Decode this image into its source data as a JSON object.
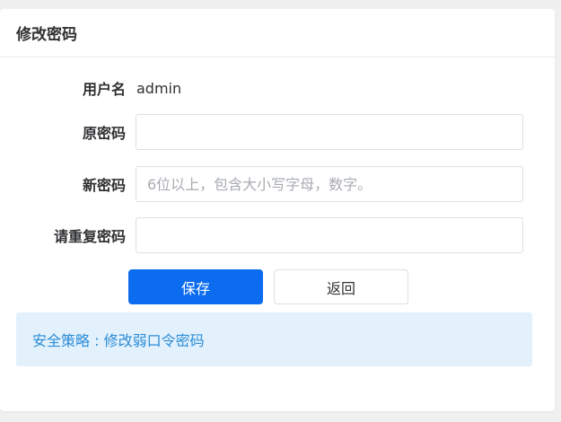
{
  "header": {
    "title": "修改密码"
  },
  "form": {
    "username": {
      "label": "用户名",
      "value": "admin"
    },
    "old_password": {
      "label": "原密码",
      "value": "",
      "placeholder": ""
    },
    "new_password": {
      "label": "新密码",
      "value": "",
      "placeholder": "6位以上，包含大小写字母，数字。"
    },
    "confirm_password": {
      "label": "请重复密码",
      "value": "",
      "placeholder": ""
    }
  },
  "actions": {
    "save_label": "保存",
    "back_label": "返回"
  },
  "notice": {
    "text": "安全策略 : 修改弱口令密码"
  },
  "colors": {
    "primary": "#0b6cf0",
    "notice_bg": "#e3f1fd",
    "notice_text": "#2a8cd6"
  }
}
